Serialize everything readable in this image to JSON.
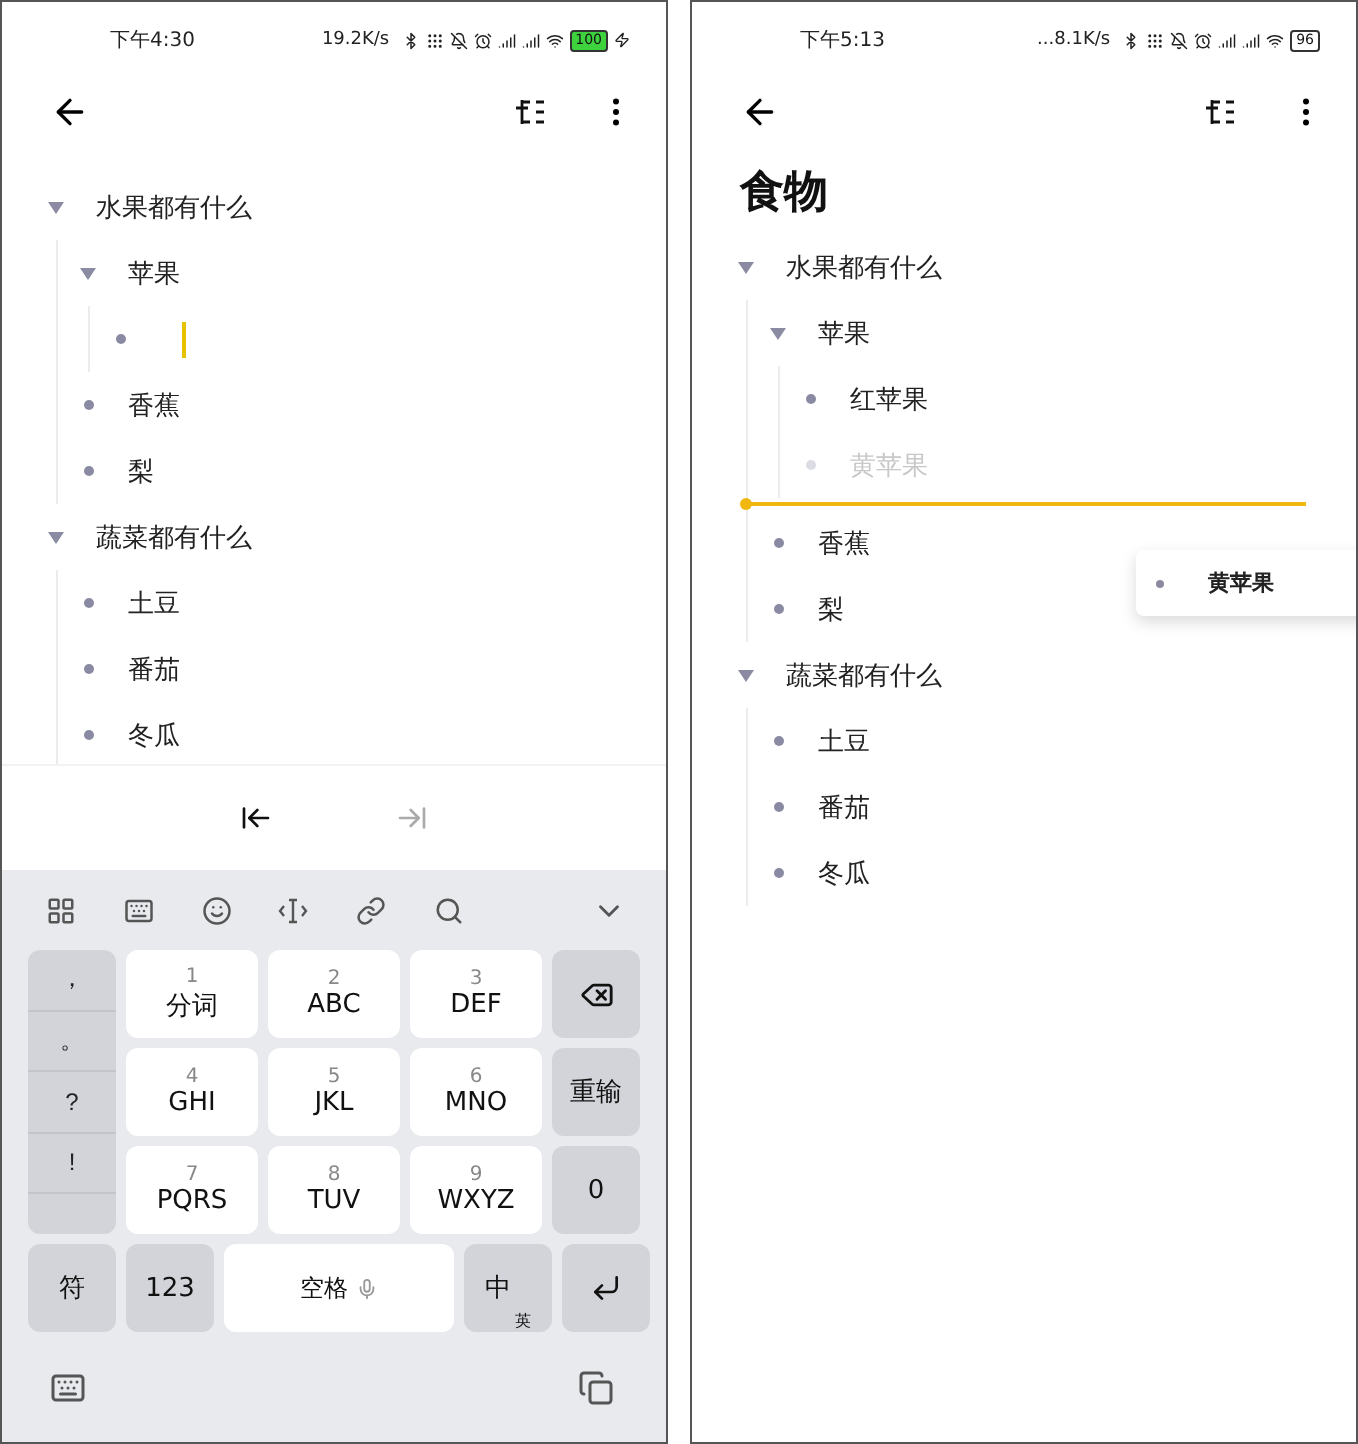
{
  "left_screen": {
    "status_bar": {
      "time": "下午4:30",
      "net_speed": "19.2K/s",
      "battery": "100",
      "charging": true
    },
    "outline": [
      {
        "text": "水果都有什么",
        "kind": "text",
        "expanded": true,
        "children": [
          {
            "text": "苹果",
            "kind": "text",
            "expanded": true,
            "children": [
              {
                "kind": "editing"
              }
            ]
          },
          {
            "text": "香蕉",
            "kind": "text"
          },
          {
            "text": "梨",
            "kind": "text"
          }
        ]
      },
      {
        "text": "蔬菜都有什么",
        "kind": "text",
        "expanded": true,
        "children": [
          {
            "text": "土豆",
            "kind": "text"
          },
          {
            "text": "番茄",
            "kind": "text"
          },
          {
            "text": "冬瓜",
            "kind": "text"
          }
        ]
      }
    ],
    "edit_actions": [
      {
        "kind": "outdent",
        "disabled": false
      },
      {
        "kind": "indent",
        "disabled": true
      }
    ],
    "keyboard": {
      "punctuation": [
        "，",
        "。",
        "?",
        "!"
      ],
      "keys": [
        {
          "digit": "1",
          "label": "分词"
        },
        {
          "digit": "2",
          "label": "ABC"
        },
        {
          "digit": "3",
          "label": "DEF"
        },
        {
          "digit": "4",
          "label": "GHI"
        },
        {
          "digit": "5",
          "label": "JKL"
        },
        {
          "digit": "6",
          "label": "MNO"
        },
        {
          "digit": "7",
          "label": "PQRS"
        },
        {
          "digit": "8",
          "label": "TUV"
        },
        {
          "digit": "9",
          "label": "WXYZ"
        }
      ],
      "side_keys": [
        {
          "kind": "backspace"
        },
        {
          "kind": "text",
          "label": "重输"
        },
        {
          "kind": "text",
          "label": "0"
        }
      ],
      "bottom_keys": [
        {
          "kind": "text",
          "label": "符"
        },
        {
          "kind": "text",
          "label": "123"
        },
        {
          "kind": "space",
          "label": "空格"
        },
        {
          "kind": "lang",
          "label": "中",
          "sub": "英"
        },
        {
          "kind": "enter"
        }
      ]
    }
  },
  "right_screen": {
    "status_bar": {
      "time": "下午5:13",
      "net_speed": "...8.1K/s",
      "battery": "96",
      "charging": false
    },
    "title": "食物",
    "outline": [
      {
        "text": "水果都有什么",
        "kind": "text",
        "expanded": true,
        "children": [
          {
            "text": "苹果",
            "kind": "text",
            "expanded": true,
            "children": [
              {
                "text": "红苹果",
                "kind": "text"
              },
              {
                "text": "黄苹果",
                "kind": "ghost"
              }
            ]
          },
          {
            "kind": "drop-line"
          },
          {
            "text": "香蕉",
            "kind": "text"
          },
          {
            "text": "梨",
            "kind": "text"
          }
        ]
      },
      {
        "text": "蔬菜都有什么",
        "kind": "text",
        "expanded": true,
        "children": [
          {
            "text": "土豆",
            "kind": "text"
          },
          {
            "text": "番茄",
            "kind": "text"
          },
          {
            "text": "冬瓜",
            "kind": "text"
          }
        ]
      }
    ],
    "drag_preview": {
      "text": "黄苹果"
    }
  }
}
